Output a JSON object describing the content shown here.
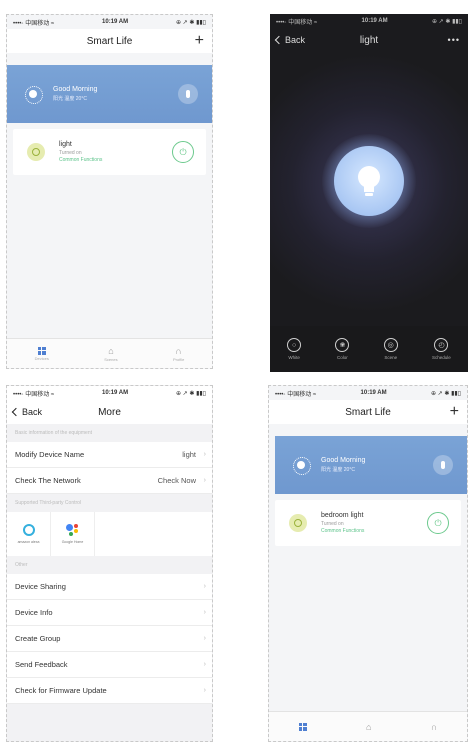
{
  "status": {
    "carrier": "••••◦ 中国移动 ≈",
    "time": "10:19 AM",
    "right": "⊕ ↗ ✱ ▮▮▯"
  },
  "screen1": {
    "title": "Smart Life",
    "add": "+",
    "greeting": "Good Morning",
    "weather_detail": "阳光 温度 20°C",
    "device_name": "light",
    "device_state": "Turned on",
    "device_function": "Common Functions",
    "tabs": [
      {
        "label": "Devices"
      },
      {
        "label": "Scenes"
      },
      {
        "label": "Profile"
      }
    ]
  },
  "screen2": {
    "back": "Back",
    "title": "light",
    "more": "•••",
    "controls": [
      {
        "label": "White"
      },
      {
        "label": "Color"
      },
      {
        "label": "Scene"
      },
      {
        "label": "Schedule"
      }
    ]
  },
  "screen3": {
    "back": "Back",
    "title": "More",
    "section_basic": "Basic information of the equipment",
    "modify_name": "Modify Device Name",
    "modify_name_value": "light",
    "check_network": "Check The Network",
    "check_network_value": "Check Now",
    "section_third": "Supported Third-party Control",
    "alexa_label": "amazon alexa",
    "google_label": "Google Home",
    "section_other": "Other",
    "items": [
      {
        "label": "Device Sharing"
      },
      {
        "label": "Device Info"
      },
      {
        "label": "Create Group"
      },
      {
        "label": "Send Feedback"
      },
      {
        "label": "Check for Firmware Update"
      }
    ]
  },
  "screen4": {
    "title": "Smart Life",
    "add": "+",
    "greeting": "Good Morning",
    "weather_detail": "阳光 温度 20°C",
    "device_name": "bedroom light",
    "device_state": "Turned on",
    "device_function": "Common Functions"
  },
  "colors": {
    "accent_blue": "#4f7fd1",
    "weather_card": "#7aa3d6",
    "power_green": "#6cc98d",
    "dark_bg": "#1b1b1e"
  }
}
